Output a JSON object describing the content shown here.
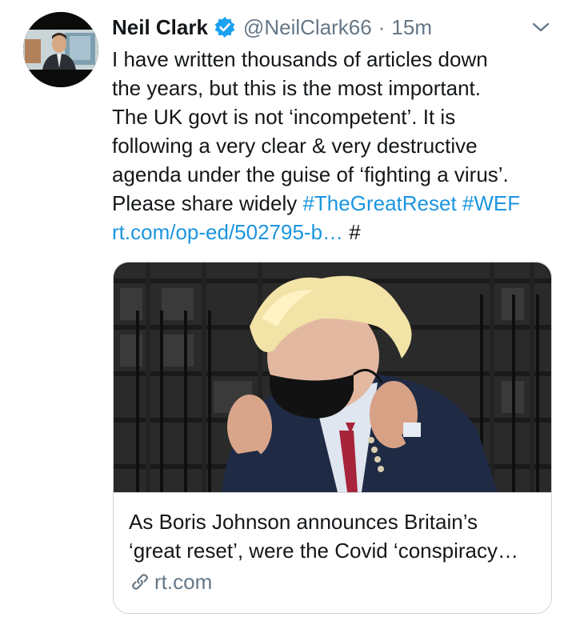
{
  "tweet": {
    "author": {
      "name": "Neil Clark",
      "handle": "@NeilClark66",
      "verified_icon": "verified-badge-icon"
    },
    "separator": "·",
    "time": "15m",
    "menu_icon": "chevron-down-icon",
    "text_lines": [
      "I have written thousands of articles down",
      "the years, but this is the most important.",
      "The UK govt is not ‘incompetent’. It is",
      "following a very clear & very destructive",
      "agenda under the guise of ‘fighting a virus’."
    ],
    "last_line_prefix": "Please share widely ",
    "hashtags": [
      "#TheGreatReset",
      "#WEF"
    ],
    "url_text": "rt.com/op-ed/502795-b…",
    "trailing_text": " #"
  },
  "card": {
    "title_lines": [
      "As Boris Johnson announces Britain’s",
      "‘great reset’, were the Covid ‘conspiracy…"
    ],
    "domain": "rt.com",
    "domain_icon": "link-icon"
  },
  "colors": {
    "link": "#1b95e0",
    "secondary_text": "#657786",
    "primary_text": "#14171a",
    "border": "#ccd6dd",
    "verified": "#1da1f2"
  }
}
